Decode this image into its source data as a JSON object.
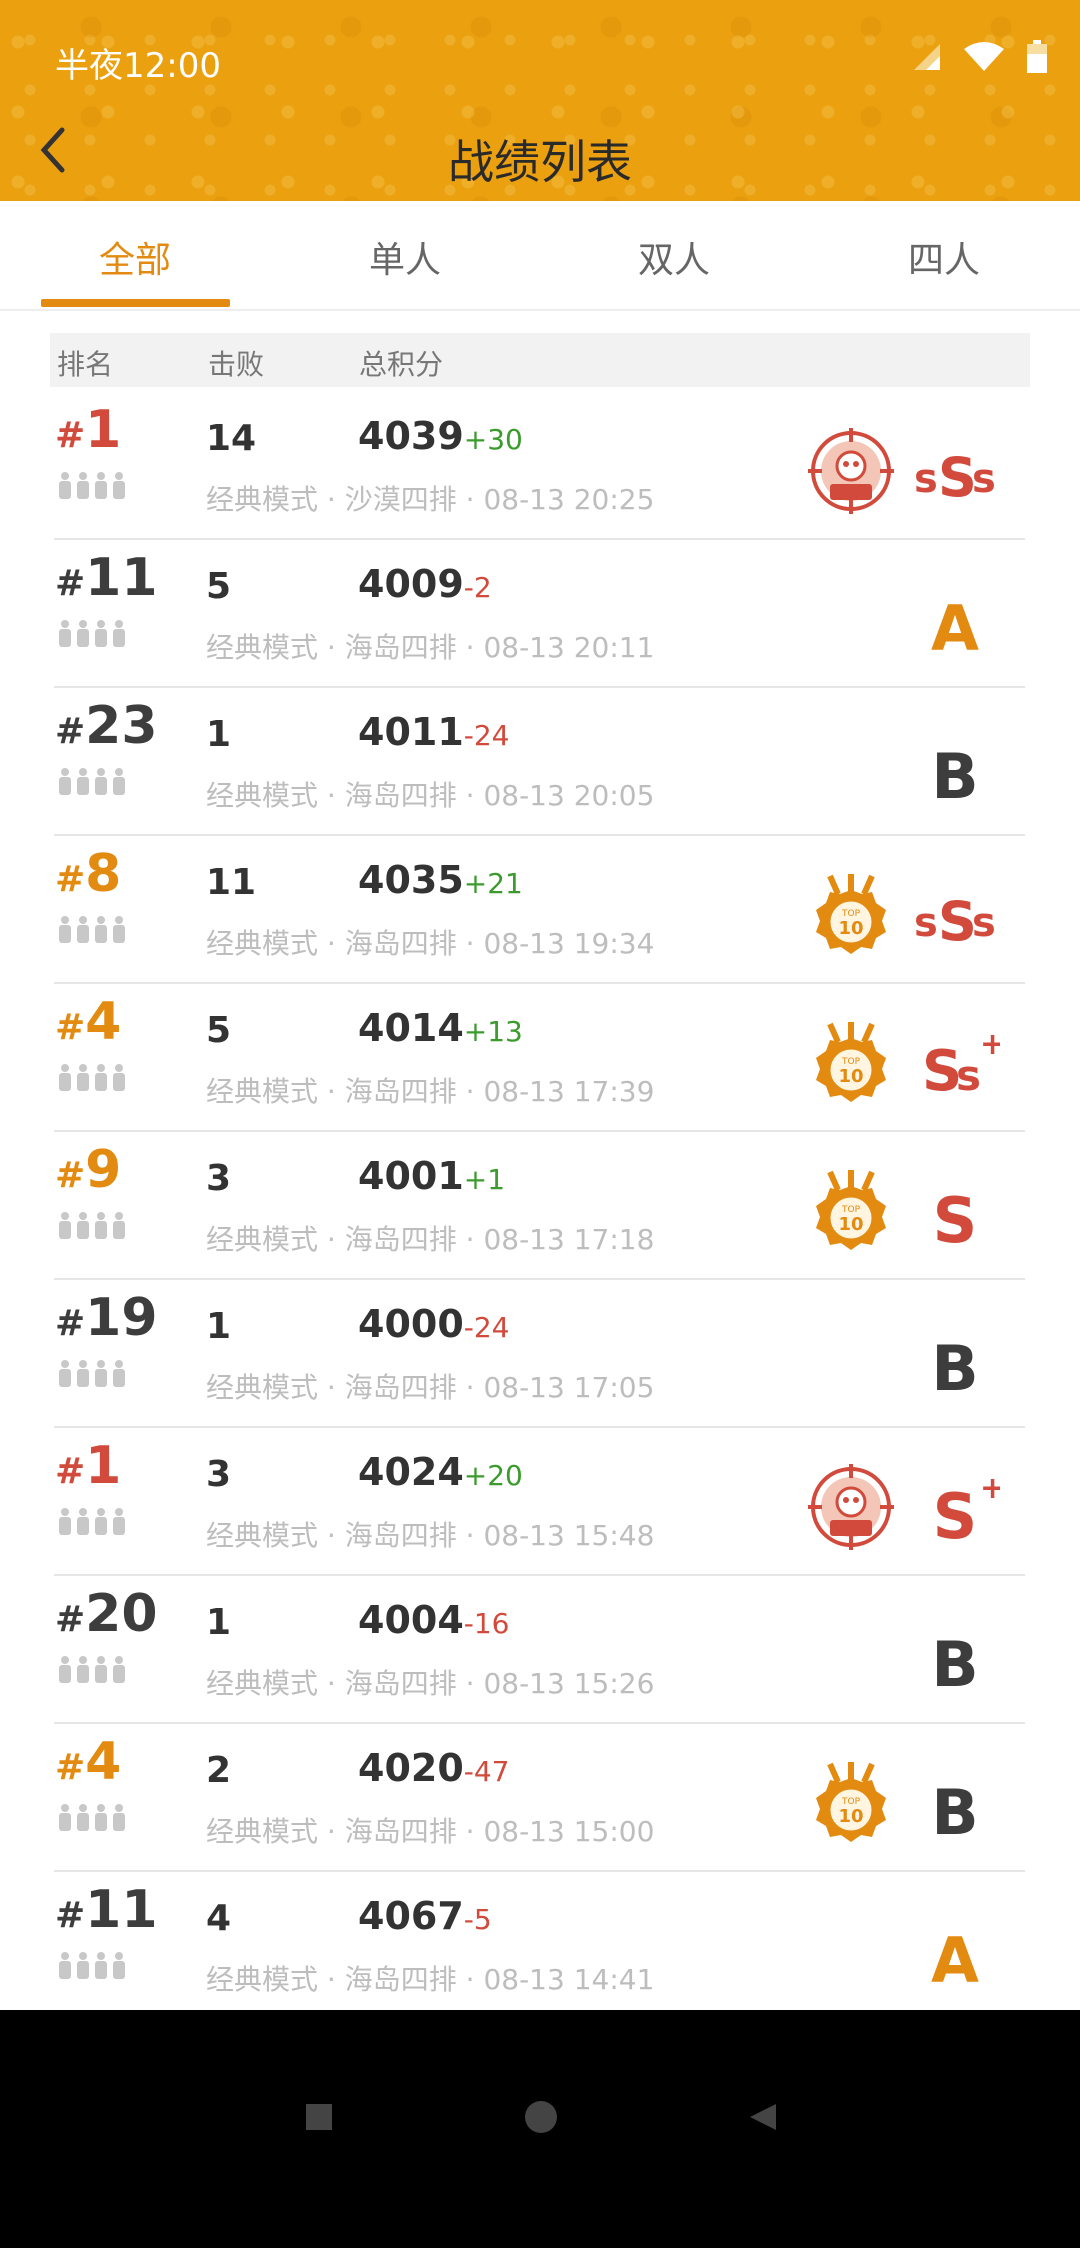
{
  "status": {
    "time": "半夜12:00"
  },
  "header": {
    "title": "战绩列表"
  },
  "tabs": [
    {
      "label": "全部"
    },
    {
      "label": "单人"
    },
    {
      "label": "双人"
    },
    {
      "label": "四人"
    }
  ],
  "columns": {
    "rank": "排名",
    "kills": "击败",
    "score": "总积分"
  },
  "colors": {
    "header": "#eaa00f",
    "accent": "#e38a11",
    "positive": "#3b9c2d",
    "negative": "#d14a3b"
  },
  "rows": [
    {
      "rank": "1",
      "kills": "14",
      "score": "4039",
      "delta": "+30",
      "mode": "经典模式",
      "map": "沙漠四排",
      "time": "08-13 20:25",
      "badge": "chicken-badge-icon",
      "grade": "SSS"
    },
    {
      "rank": "11",
      "kills": "5",
      "score": "4009",
      "delta": "-2",
      "mode": "经典模式",
      "map": "海岛四排",
      "time": "08-13 20:11",
      "badge": "",
      "grade": "A"
    },
    {
      "rank": "23",
      "kills": "1",
      "score": "4011",
      "delta": "-24",
      "mode": "经典模式",
      "map": "海岛四排",
      "time": "08-13 20:05",
      "badge": "",
      "grade": "B"
    },
    {
      "rank": "8",
      "kills": "11",
      "score": "4035",
      "delta": "+21",
      "mode": "经典模式",
      "map": "海岛四排",
      "time": "08-13 19:34",
      "badge": "top10-badge-icon",
      "grade": "SSS"
    },
    {
      "rank": "4",
      "kills": "5",
      "score": "4014",
      "delta": "+13",
      "mode": "经典模式",
      "map": "海岛四排",
      "time": "08-13 17:39",
      "badge": "top10-badge-icon",
      "grade": "SS+"
    },
    {
      "rank": "9",
      "kills": "3",
      "score": "4001",
      "delta": "+1",
      "mode": "经典模式",
      "map": "海岛四排",
      "time": "08-13 17:18",
      "badge": "top10-badge-icon",
      "grade": "S"
    },
    {
      "rank": "19",
      "kills": "1",
      "score": "4000",
      "delta": "-24",
      "mode": "经典模式",
      "map": "海岛四排",
      "time": "08-13 17:05",
      "badge": "",
      "grade": "B"
    },
    {
      "rank": "1",
      "kills": "3",
      "score": "4024",
      "delta": "+20",
      "mode": "经典模式",
      "map": "海岛四排",
      "time": "08-13 15:48",
      "badge": "chicken-badge-icon",
      "grade": "S+"
    },
    {
      "rank": "20",
      "kills": "1",
      "score": "4004",
      "delta": "-16",
      "mode": "经典模式",
      "map": "海岛四排",
      "time": "08-13 15:26",
      "badge": "",
      "grade": "B"
    },
    {
      "rank": "4",
      "kills": "2",
      "score": "4020",
      "delta": "-47",
      "mode": "经典模式",
      "map": "海岛四排",
      "time": "08-13 15:00",
      "badge": "top10-badge-icon",
      "grade": "B"
    },
    {
      "rank": "11",
      "kills": "4",
      "score": "4067",
      "delta": "-5",
      "mode": "经典模式",
      "map": "海岛四排",
      "time": "08-13 14:41",
      "badge": "",
      "grade": "A"
    }
  ]
}
